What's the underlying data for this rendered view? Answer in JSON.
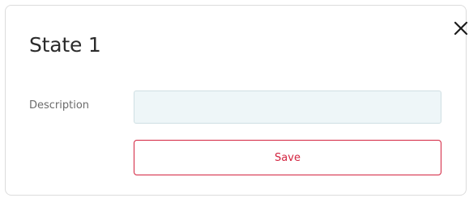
{
  "dialog": {
    "title": "State 1",
    "close_icon": "close-icon"
  },
  "form": {
    "description_label": "Description",
    "description_value": "",
    "description_placeholder": ""
  },
  "actions": {
    "save_label": "Save"
  },
  "colors": {
    "accent": "#d3233f",
    "input_background": "#eef6f8",
    "title_text": "#2b2b2b",
    "label_text": "#6b6b6b"
  }
}
